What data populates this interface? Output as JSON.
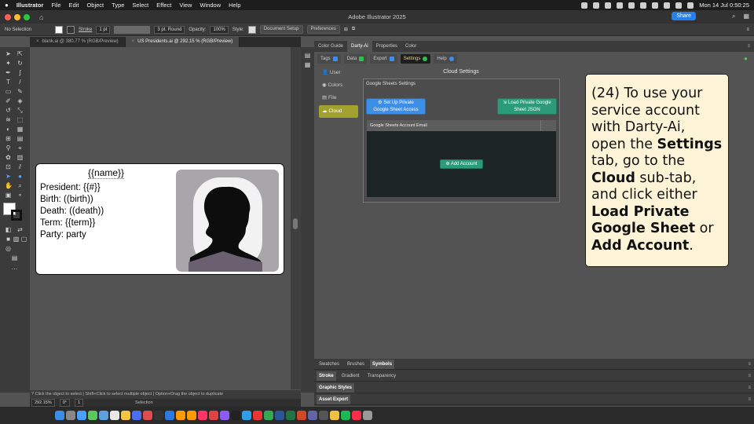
{
  "menubar": {
    "app": "Illustrator",
    "items": [
      "File",
      "Edit",
      "Object",
      "Type",
      "Select",
      "Effect",
      "View",
      "Window",
      "Help"
    ],
    "clock": "Mon 14 Jul  0:50:25"
  },
  "window": {
    "title": "Adobe Illustrator 2025",
    "share_label": "Share"
  },
  "controlbar": {
    "selection": "No Selection",
    "stroke_label": "Stroke",
    "stroke_value": "1 pt",
    "brush": "3 pt. Round",
    "opacity_label": "Opacity:",
    "opacity_value": "100%",
    "style_label": "Style:",
    "doc_setup": "Document Setup",
    "preferences": "Preferences"
  },
  "doc_tabs": [
    {
      "label": "blank.ai @ 380.77 % (RGB/Preview)",
      "active": false
    },
    {
      "label": "US Presidents.ai @ 292.15 % (RGB/Preview)",
      "active": true
    }
  ],
  "artboard": {
    "name_field": "{{name}}",
    "lines": [
      "President: {{#}}",
      "Birth: ((birth))",
      "Death: ((death))",
      "Term: {{term}}",
      "Party: party"
    ]
  },
  "statusbar": {
    "hint": "Click the object to select  |  Shift+Click to select multiple object  |  Option+Drag the object to duplicate",
    "zoom": "292.15%",
    "rotation": "0°",
    "artboard_num": "1",
    "tool": "Selection"
  },
  "right_tabs": [
    "Color Guide",
    "Darty-Ai",
    "Properties",
    "Color"
  ],
  "darty": {
    "subtabs": [
      "Tags",
      "Data",
      "Export",
      "Settings",
      "Help"
    ],
    "sidenav": [
      "User",
      "Colors",
      "File",
      "Cloud"
    ],
    "section_title": "Cloud Settings",
    "box_title": "Google Sheets Settings",
    "setup_btn_line1": "Set Up Private",
    "setup_btn_line2": "Google Sheet Access",
    "load_btn_line1": "Load Private Google",
    "load_btn_line2": "Sheet JSON",
    "table_header": "Google Sheets Account Email",
    "add_btn": "Add Account"
  },
  "callout": {
    "p1": "(24) To use your service account with Darty-Ai, open the ",
    "b1": "Settings",
    "p2": " tab, go to the ",
    "b2": "Cloud",
    "p3": " sub-tab, and click either ",
    "b3": "Load Private Google Sheet",
    "p4": " or ",
    "b4": "Add Account",
    "p5": "."
  },
  "bottom_panels": {
    "row1": [
      "Swatches",
      "Brushes",
      "Symbols"
    ],
    "row2": [
      "Stroke",
      "Gradient",
      "Transparency"
    ],
    "row3": "Graphic Styles",
    "row4": "Asset Export"
  },
  "colors": {
    "accent_blue": "#3d8ee6",
    "accent_green": "#2b9b7a",
    "cloud_active": "#a1a12e",
    "callout_bg": "#fdf4d8"
  }
}
